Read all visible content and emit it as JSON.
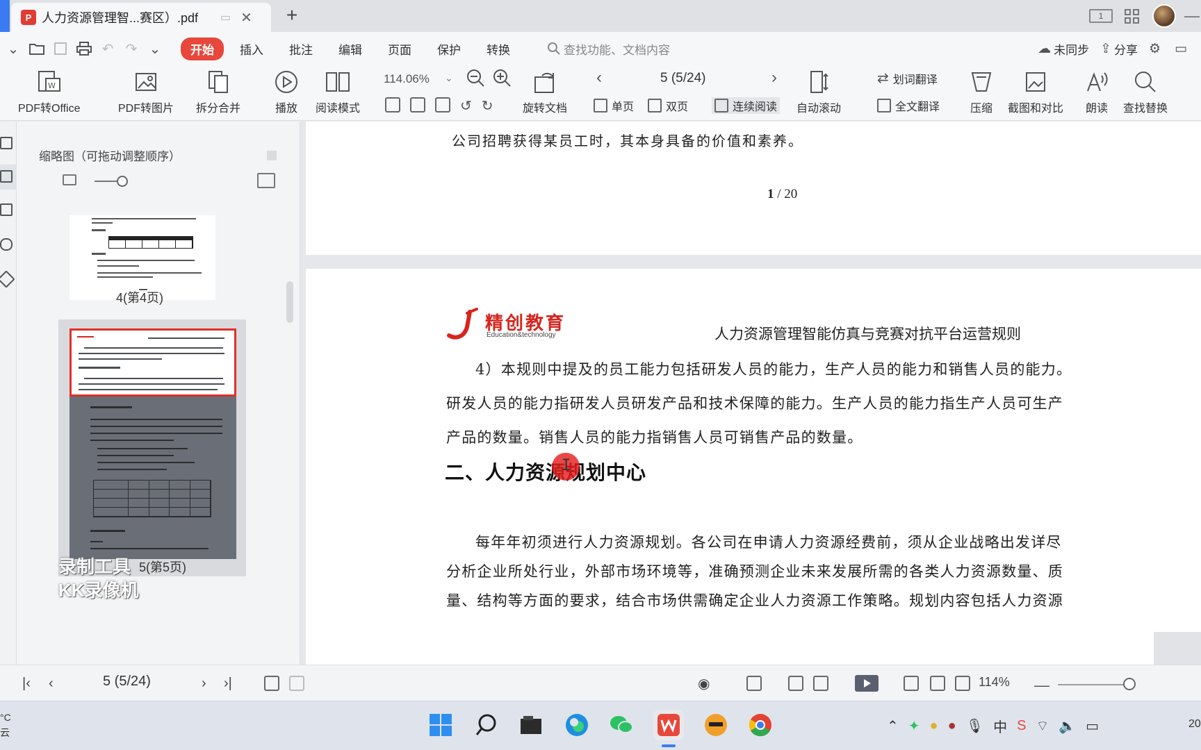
{
  "tab": {
    "title": "人力资源管理智...赛区）.pdf",
    "badge": "P"
  },
  "window": {
    "view_badge": "1"
  },
  "menu": {
    "items": [
      "开始",
      "插入",
      "批注",
      "编辑",
      "页面",
      "保护",
      "转换"
    ],
    "active_index": 0,
    "search_placeholder": "查找功能、文档内容",
    "sync_label": "未同步",
    "share_label": "分享"
  },
  "ribbon": {
    "pdf_to_office": "PDF转Office",
    "pdf_to_image": "PDF转图片",
    "split_merge": "拆分合并",
    "play": "播放",
    "read_mode": "阅读模式",
    "zoom": "114.06%",
    "rotate": "旋转文档",
    "single_page": "单页",
    "double_page": "双页",
    "continuous": "连续阅读",
    "page_indicator": "5 (5/24)",
    "auto_scroll": "自动滚动",
    "word_translate": "划词翻译",
    "full_translate": "全文翻译",
    "compress": "压缩",
    "screenshot_compare": "截图和对比",
    "read_aloud": "朗读",
    "find_replace": "查找替换"
  },
  "sidebar": {
    "title": "缩略图（可拖动调整顺序）",
    "thumbs": [
      {
        "label": "4(第4页)"
      },
      {
        "label": "5(第5页)"
      }
    ],
    "watermark_line1": "录制工具",
    "watermark_line2": "KK录像机"
  },
  "document": {
    "prev_page_tail": "公司招聘获得某员工时，其本身具备的价值和素养。",
    "page_number_current": "1",
    "page_number_rest": " / 20",
    "logo_cn": "精创教育",
    "logo_en": "Education&technology",
    "header_title": "人力资源管理智能仿真与竞赛对抗平台运营规则",
    "para1": [
      "4）本规则中提及的员工能力包括研发人员的能力，生产人员的能力和销售人员的能力。",
      "研发人员的能力指研发人员研发产品和技术保障的能力。生产人员的能力指生产人员可生产",
      "产品的数量。销售人员的能力指销售人员可销售产品的数量。"
    ],
    "section_title": "二、人力资源规划中心",
    "para2": [
      "每年年初须进行人力资源规划。各公司在申请人力资源经费前，须从企业战略出发详尽",
      "分析企业所处行业，外部市场环境等，准确预测企业未来发展所需的各类人力资源数量、质",
      "量、结构等方面的要求，结合市场供需确定企业人力资源工作策略。规划内容包括人力资源"
    ]
  },
  "statusbar": {
    "page": "5 (5/24)",
    "zoom": "114%"
  },
  "taskbar": {
    "weather_line1": "°C",
    "weather_line2": "云",
    "ime_label": "中",
    "clock": "20"
  },
  "colors": {
    "accent_red": "#e8473c",
    "brand_blue": "#3a7bf2",
    "logo_red": "#d7251d"
  }
}
